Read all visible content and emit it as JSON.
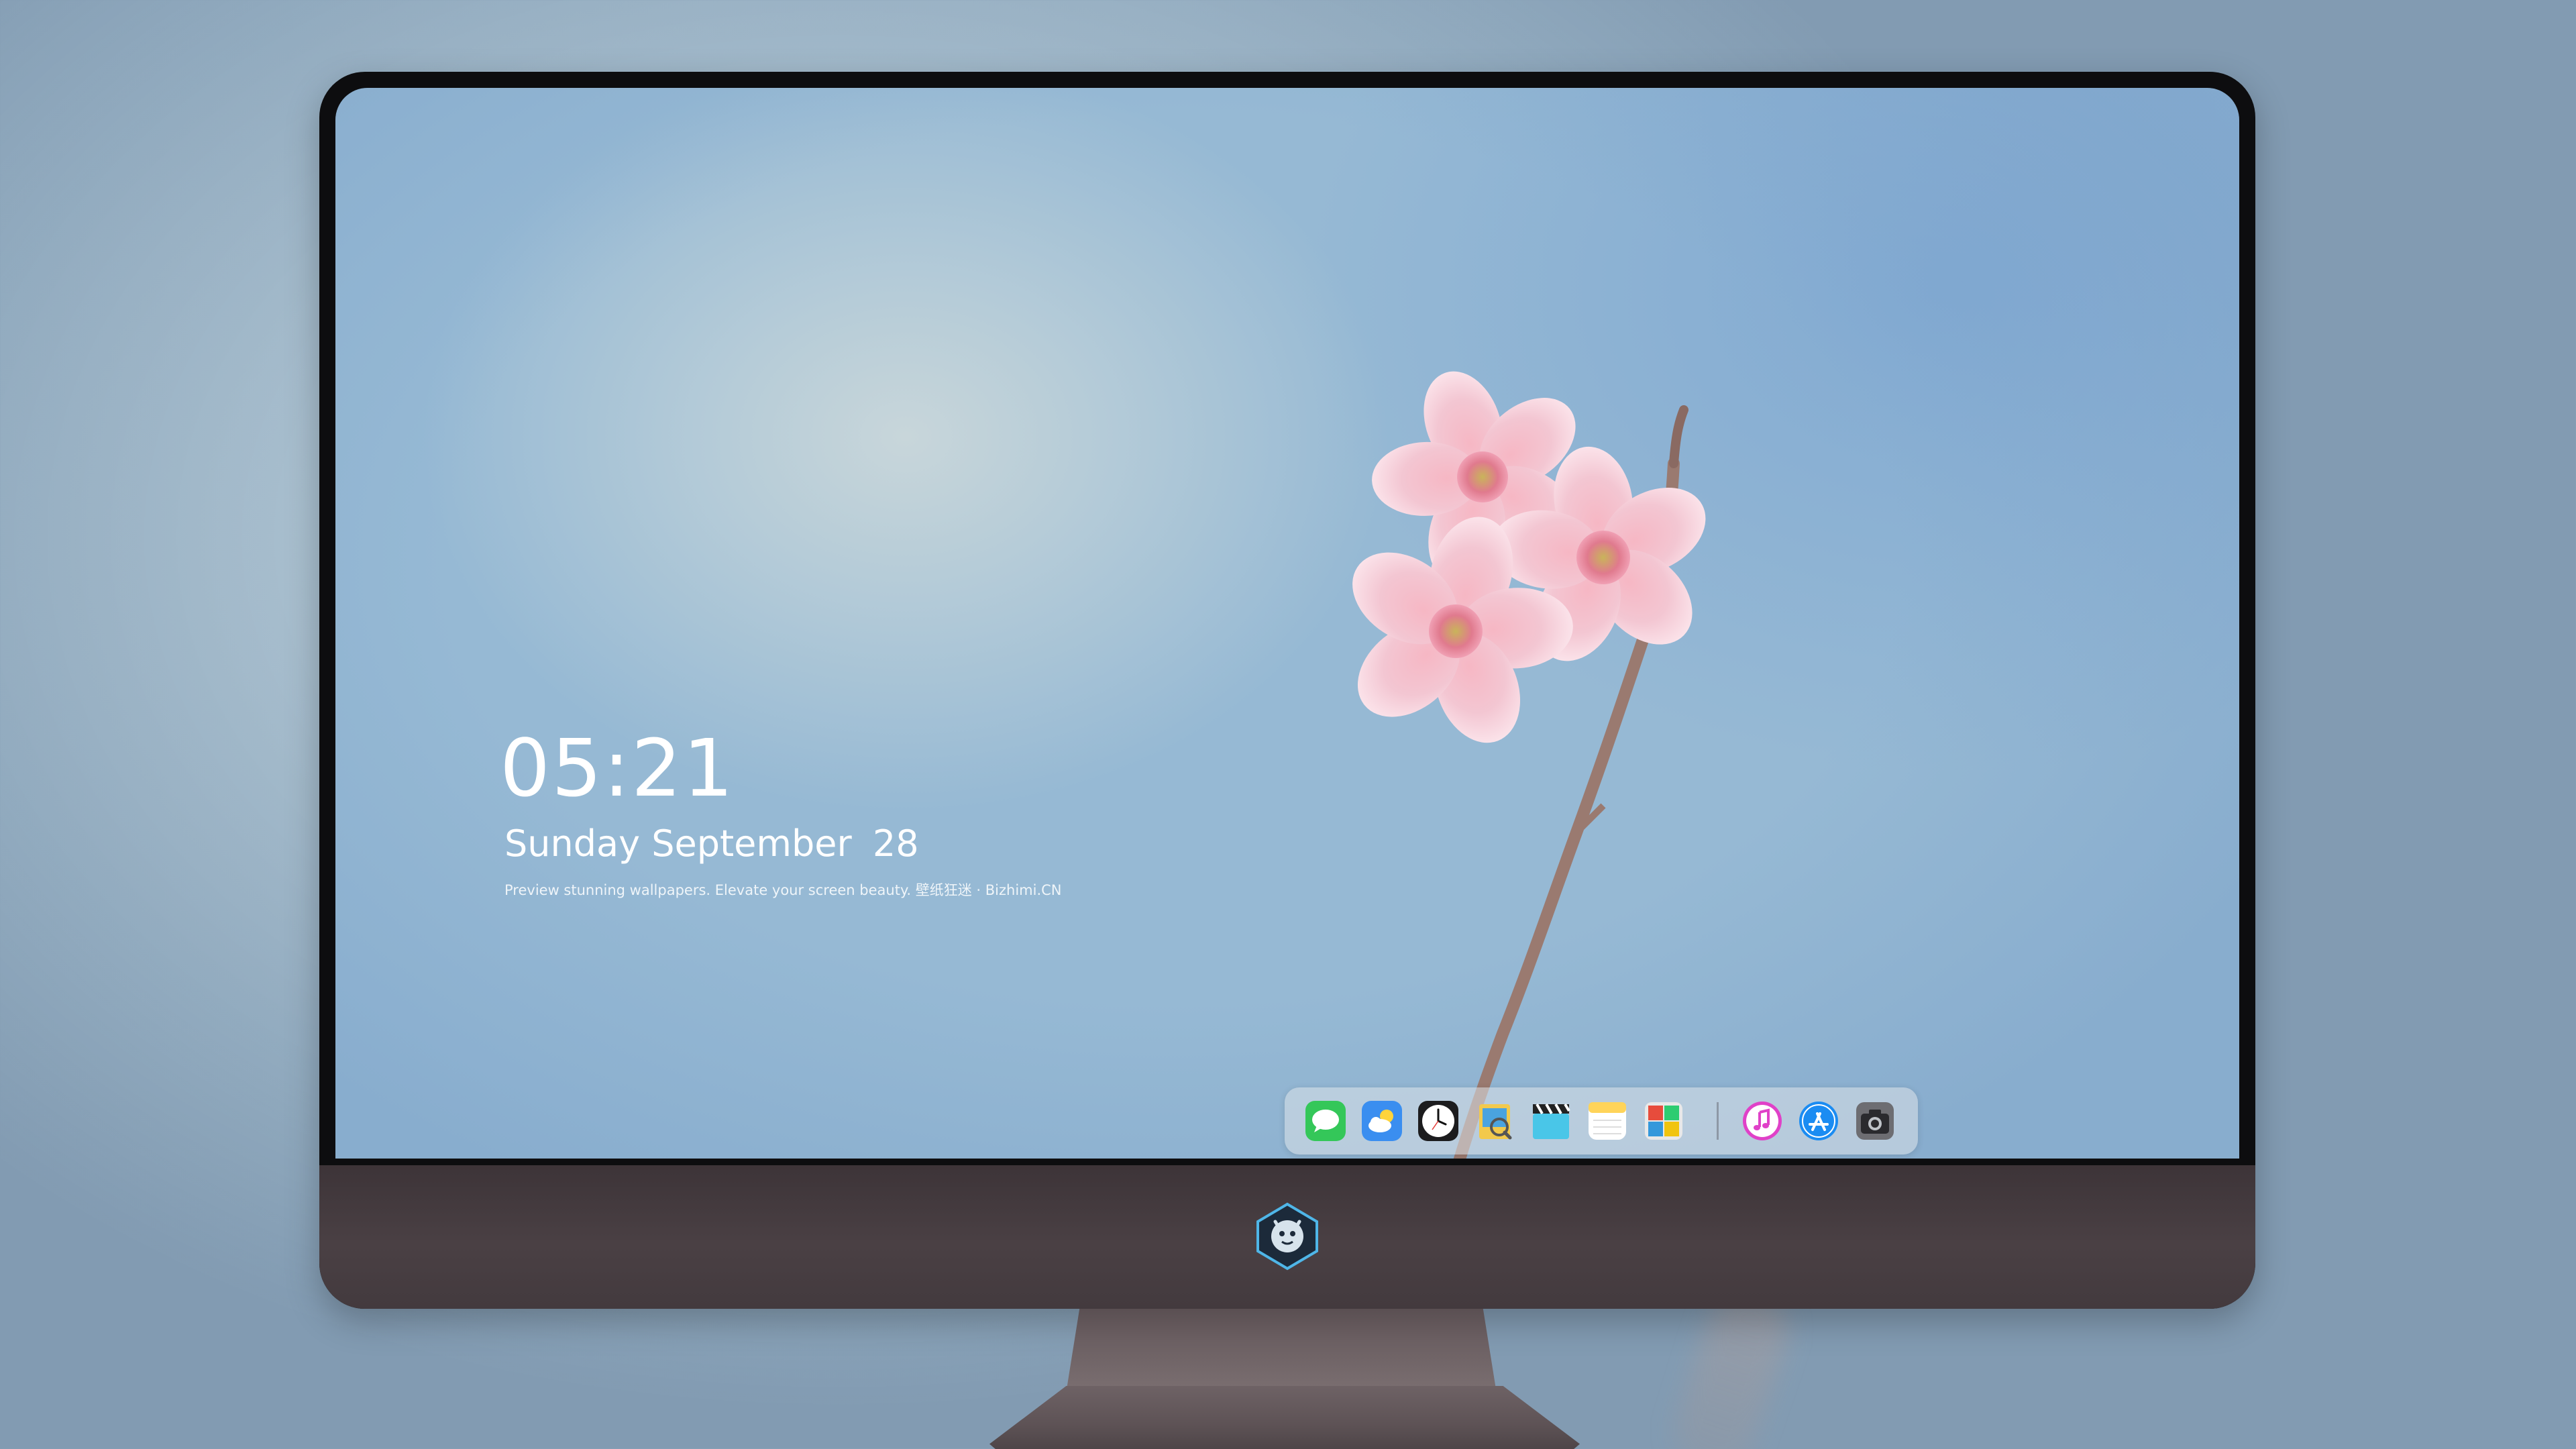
{
  "lockscreen": {
    "time": "05:21",
    "weekday": "Sunday",
    "month": "September",
    "day": "28",
    "tagline": "Preview stunning wallpapers. Elevate your screen beauty. 壁纸狂迷 · Bizhimi.CN"
  },
  "dock": {
    "apps": [
      {
        "name": "messages-icon",
        "color": "#34c759"
      },
      {
        "name": "weather-icon",
        "color": "#3a8ef0"
      },
      {
        "name": "clock-icon",
        "color": "#1c1c1e"
      },
      {
        "name": "preview-icon",
        "color": "#f2c94c"
      },
      {
        "name": "clips-icon",
        "color": "#49c6e8"
      },
      {
        "name": "notes-icon",
        "color": "#ffd45a"
      },
      {
        "name": "photo-booth-icon",
        "color": "#e8e8e8"
      }
    ],
    "pinned": [
      {
        "name": "itunes-icon",
        "color": "#e041c8"
      },
      {
        "name": "app-store-icon",
        "color": "#1b8cf2"
      },
      {
        "name": "camera-icon",
        "color": "#6d6d72"
      }
    ]
  },
  "colors": {
    "screen_sky": "#9ebcd6",
    "bezel": "#0d0d0f",
    "chin": "#453c40"
  }
}
